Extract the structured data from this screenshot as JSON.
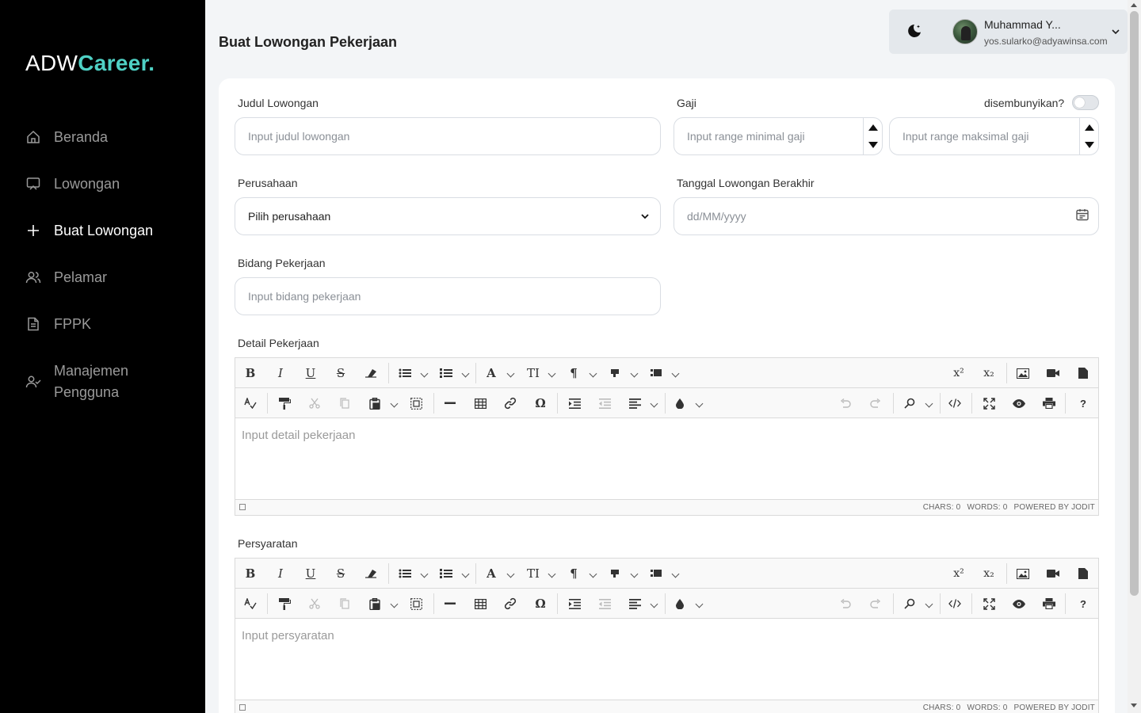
{
  "sidebar": {
    "logo_part1": "ADW",
    "logo_part2": "Career.",
    "items": [
      {
        "label": "Beranda",
        "icon": "home-icon"
      },
      {
        "label": "Lowongan",
        "icon": "monitor-icon"
      },
      {
        "label": "Buat Lowongan",
        "icon": "plus-icon",
        "active": true
      },
      {
        "label": "Pelamar",
        "icon": "users-icon"
      },
      {
        "label": "FPPK",
        "icon": "document-icon"
      },
      {
        "label": "Manajemen Pengguna",
        "line1": "Manajemen",
        "line2": "Pengguna",
        "icon": "user-check-icon"
      }
    ]
  },
  "header": {
    "title": "Buat Lowongan Pekerjaan",
    "user_name": "Muhammad Y...",
    "user_email": "yos.sularko@adyawinsa.com"
  },
  "form": {
    "judul_label": "Judul Lowongan",
    "judul_placeholder": "Input judul lowongan",
    "gaji_label": "Gaji",
    "hidden_label": "disembunyikan?",
    "gaji_min_placeholder": "Input range minimal gaji",
    "gaji_max_placeholder": "Input range maksimal gaji",
    "perusahaan_label": "Perusahaan",
    "perusahaan_value": "Pilih perusahaan",
    "tanggal_label": "Tanggal Lowongan Berakhir",
    "tanggal_placeholder": "dd/MM/yyyy",
    "bidang_label": "Bidang Pekerjaan",
    "bidang_placeholder": "Input bidang pekerjaan",
    "detail_label": "Detail Pekerjaan",
    "detail_placeholder": "Input detail pekerjaan",
    "persyaratan_label": "Persyaratan",
    "persyaratan_placeholder": "Input persyaratan"
  },
  "editor": {
    "chars": "CHARS: 0",
    "words": "WORDS: 0",
    "powered": "POWERED BY JODIT"
  },
  "colors": {
    "brand_accent": "#4fd1c5",
    "sidebar_bg": "#000000"
  }
}
